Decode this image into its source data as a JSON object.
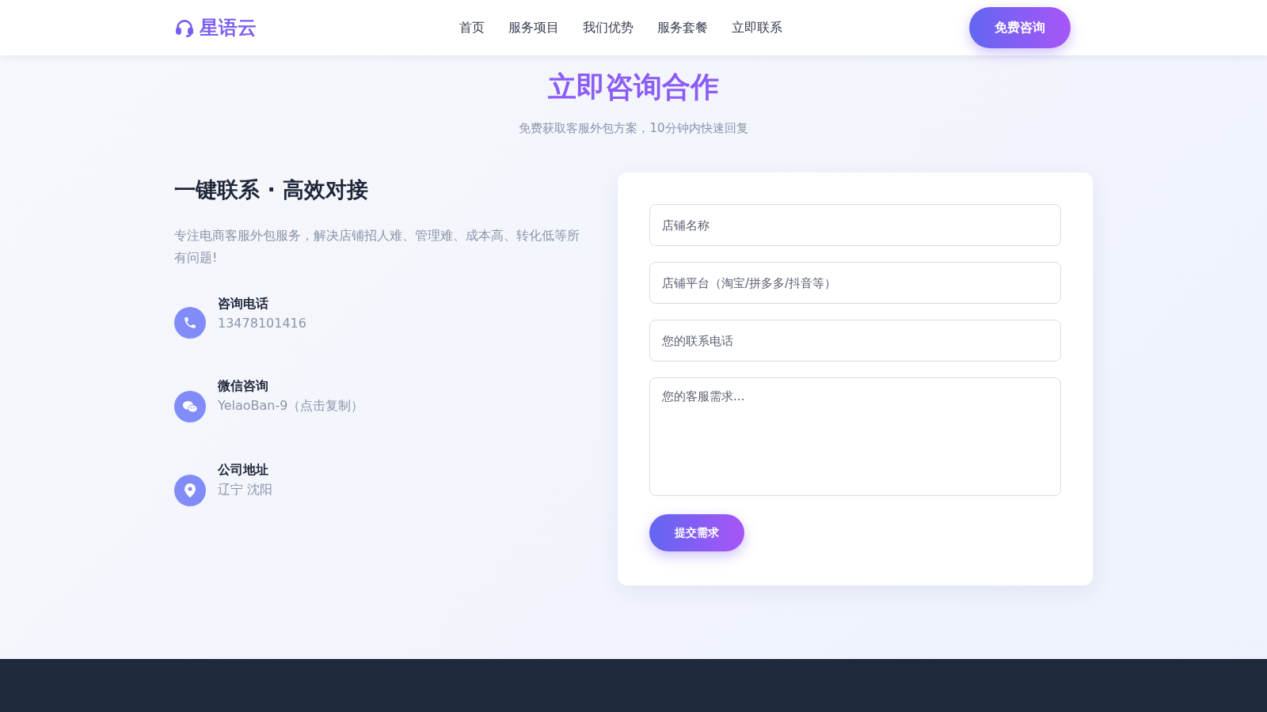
{
  "header": {
    "logo": "星语云",
    "nav": [
      {
        "label": "首页"
      },
      {
        "label": "服务项目"
      },
      {
        "label": "我们优势"
      },
      {
        "label": "服务套餐"
      },
      {
        "label": "立即联系"
      }
    ],
    "cta": "免费咨询"
  },
  "section": {
    "title": "立即咨询合作",
    "subtitle": "免费获取客服外包方案，10分钟内快速回复"
  },
  "intro": {
    "heading": "一键联系 · 高效对接",
    "text": "专注电商客服外包服务，解决店铺招人难、管理难、成本高、转化低等所有问题!"
  },
  "contacts": [
    {
      "kind": "phone",
      "label": "咨询电话",
      "value": "13478101416"
    },
    {
      "kind": "wechat",
      "label": "微信咨询",
      "value": "YelaoBan-9（点击复制）"
    },
    {
      "kind": "location",
      "label": "公司地址",
      "value": "辽宁 沈阳"
    }
  ],
  "form": {
    "fields": [
      {
        "kind": "input",
        "placeholder": "店铺名称"
      },
      {
        "kind": "input",
        "placeholder": "店铺平台（淘宝/拼多多/抖音等）"
      },
      {
        "kind": "input",
        "placeholder": "您的联系电话"
      },
      {
        "kind": "textarea",
        "placeholder": "您的客服需求..."
      }
    ],
    "submit": "提交需求"
  }
}
